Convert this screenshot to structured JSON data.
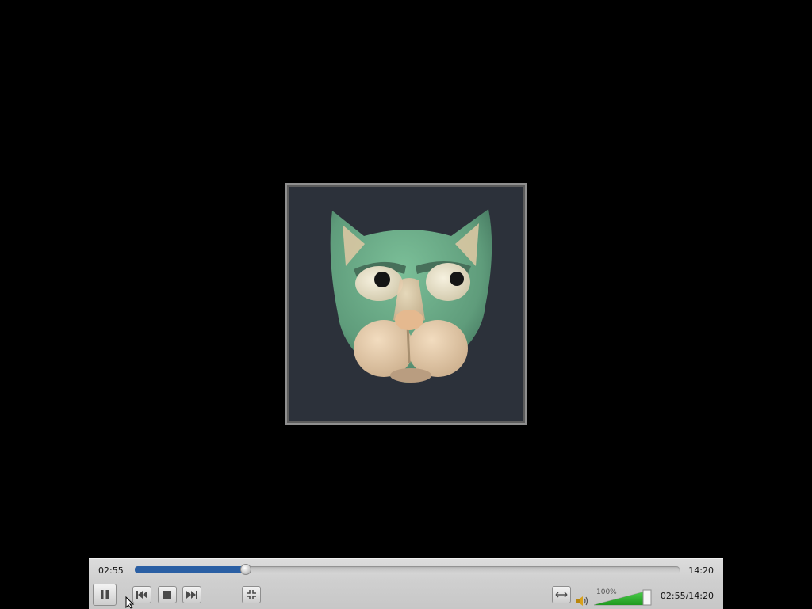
{
  "player": {
    "elapsed": "02:55",
    "total": "14:20",
    "combined_time": "02:55/14:20",
    "progress_fraction": 0.2035,
    "volume_label": "100%",
    "volume_fraction": 1.0,
    "colors": {
      "seek_fill": "#2a5fa4",
      "volume_fill": "#22aa22"
    }
  },
  "controls": {
    "pause_icon": "pause-icon",
    "previous_icon": "skip-back-icon",
    "stop_icon": "stop-icon",
    "next_icon": "skip-forward-icon",
    "fullscreen_icon": "fullscreen-toggle-icon",
    "aspect_icon": "aspect-ratio-icon",
    "volume_icon": "speaker-icon"
  }
}
